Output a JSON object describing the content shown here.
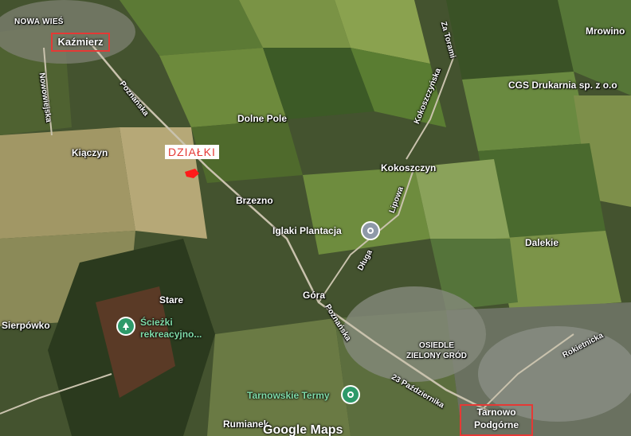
{
  "map": {
    "places": {
      "nowa_wies": "NOWA WIEŚ",
      "kazmierz": "Kaźmierz",
      "mrowino": "Mrowino",
      "cgs": "CGS Drukarnia sp. z o.o",
      "dolne_pole": "Dolne Pole",
      "kiaczyn": "Kiączyn",
      "dzialki": "DZIAŁKI",
      "kokoszczyn": "Kokoszczyn",
      "brzezno": "Brzezno",
      "iglaki": "Iglaki Plantacja",
      "dalekie": "Dalekie",
      "stare": "Stare",
      "gora": "Góra",
      "sierpowko": "Sierpówko",
      "sciezki_line1": "Ścieżki",
      "sciezki_line2": "rekreacyjno...",
      "osiedle_line1": "OSIEDLE",
      "osiedle_line2": "ZIELONY GRÓD",
      "tarnowskie": "Tarnowskie Termy",
      "rumianek": "Rumianek",
      "tarnowo_line1": "Tarnowo",
      "tarnowo_line2": "Podgórne"
    },
    "roads": {
      "nowowiejska": "Nowowiejska",
      "poznanska_n": "Poznańska",
      "za_torami": "Za Torami",
      "kokoszczynska": "Kokoszczyńska",
      "lipowa": "Lipowa",
      "dluga": "Długa",
      "poznanska_s": "Poznańska",
      "pazdziernika": "23 Października",
      "rokietnicka": "Rokietnicka"
    },
    "icons": {
      "iglaki": "location-pin-icon",
      "sciezki": "tree-icon",
      "tarnowskie": "location-pin-icon"
    },
    "colors": {
      "highlight_box": "#e53935",
      "plot_marker": "#ff1a1a",
      "poi_green": "#2e9a6a",
      "poi_gray": "#8e99a8"
    },
    "attribution": "Google Maps"
  }
}
